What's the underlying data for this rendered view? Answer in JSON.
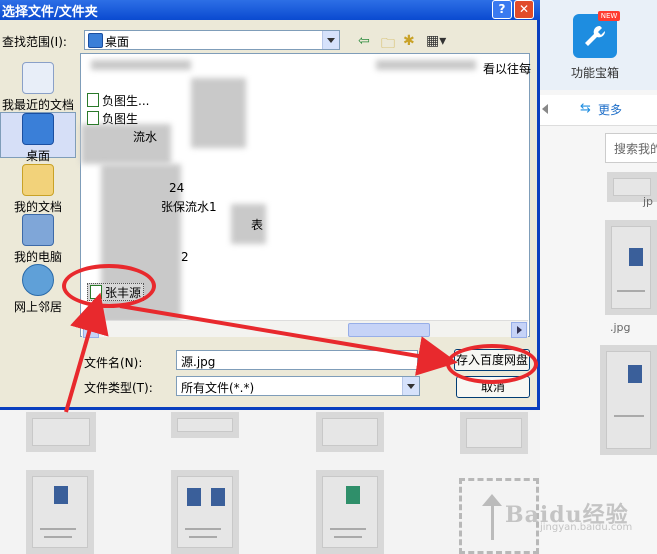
{
  "dialog": {
    "title": "选择文件/文件夹",
    "help_btn": "?",
    "close_btn": "✕",
    "look_in_label": "查找范围(I):",
    "look_in_value": "桌面",
    "places": [
      {
        "label": "我最近的文档",
        "icon": "recent-docs-icon"
      },
      {
        "label": "桌面",
        "icon": "desktop-icon"
      },
      {
        "label": "我的文档",
        "icon": "my-documents-icon"
      },
      {
        "label": "我的电脑",
        "icon": "my-computer-icon"
      },
      {
        "label": "网上邻居",
        "icon": "network-icon"
      }
    ],
    "files": [
      {
        "name": "负图生..."
      },
      {
        "name": "负图生"
      },
      {
        "name": "流水"
      },
      {
        "name": "24"
      },
      {
        "name": "张保流水1"
      },
      {
        "name": "表"
      },
      {
        "name": "2"
      },
      {
        "name": "张丰源"
      }
    ],
    "right_text": "看以往每",
    "filename_label": "文件名(N):",
    "filename_value": "源.jpg",
    "filetype_label": "文件类型(T):",
    "filetype_value": "所有文件(*.*)",
    "save_button": "存入百度网盘",
    "cancel_button": "取消"
  },
  "background": {
    "tool_label": "功能宝箱",
    "new_badge": "NEW",
    "more_label": "更多",
    "search_placeholder": "搜索我的",
    "jpg_label": ".jpg",
    "jpg_label2": "jp",
    "watermark": "Baidu经验",
    "watermark_sub": "jingyan.baidu.com"
  },
  "colors": {
    "titlebar": "#0a4ad0",
    "annotation_red": "#e8292d",
    "accent_blue": "#1e8de0"
  }
}
